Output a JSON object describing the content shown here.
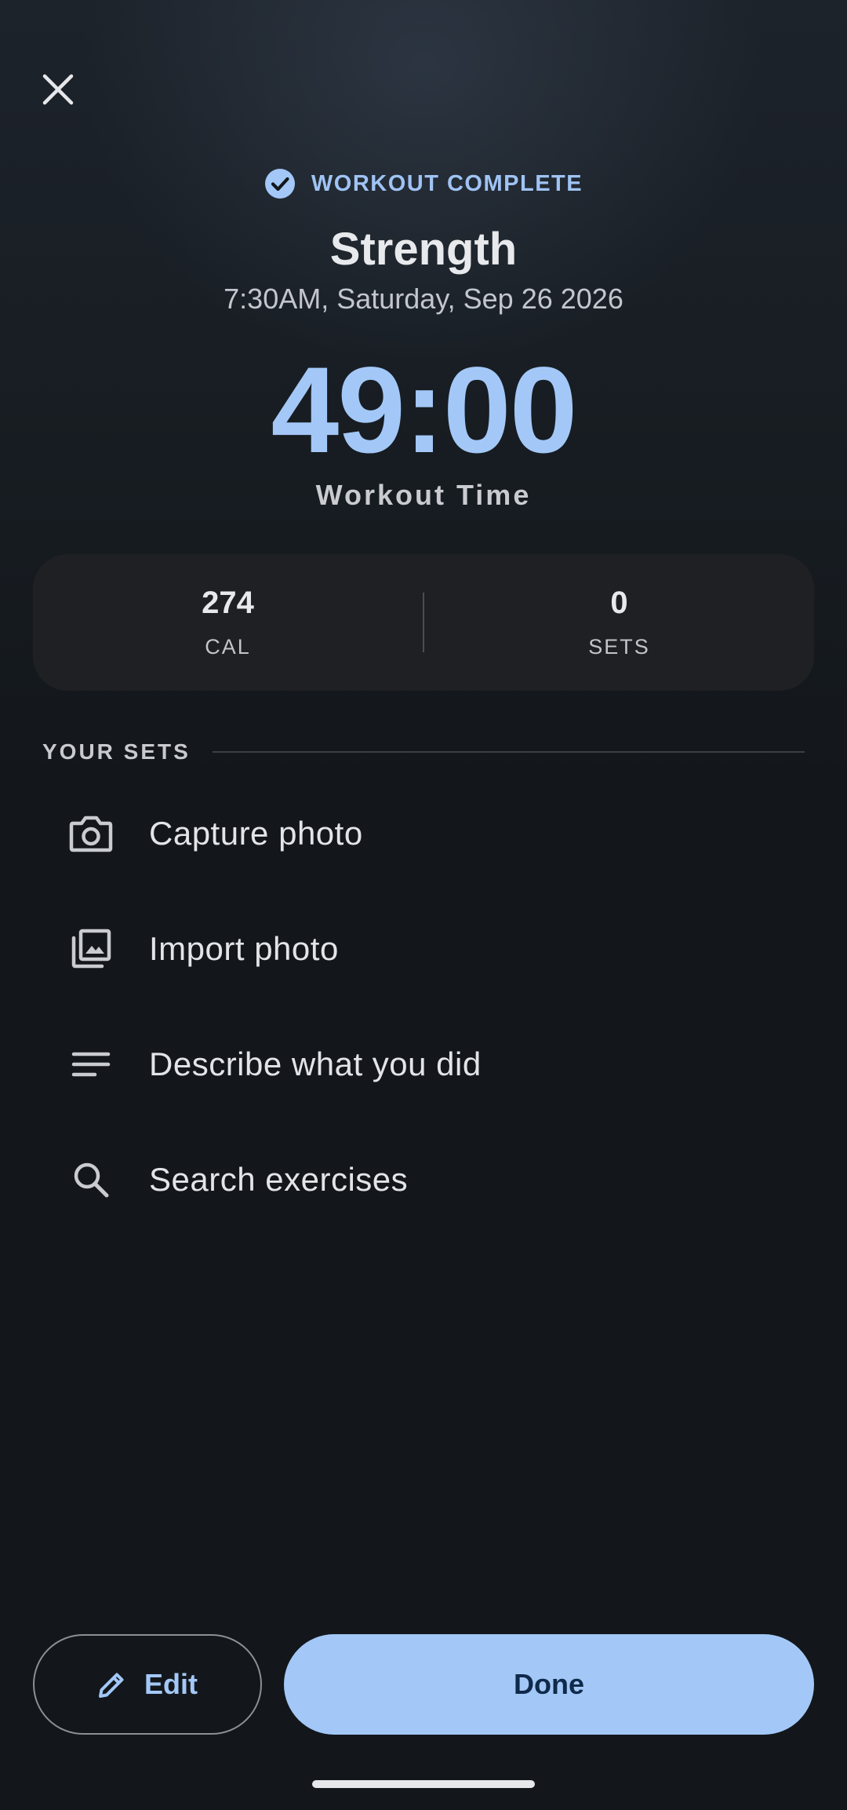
{
  "header": {
    "status": "WORKOUT COMPLETE",
    "title": "Strength",
    "datetime": "7:30AM, Saturday, Sep 26 2026"
  },
  "timer": {
    "value": "49:00",
    "label": "Workout Time"
  },
  "stats": [
    {
      "value": "274",
      "label": "CAL"
    },
    {
      "value": "0",
      "label": "SETS"
    }
  ],
  "sets_section": {
    "title": "YOUR SETS",
    "options": [
      {
        "label": "Capture photo",
        "icon": "camera-icon"
      },
      {
        "label": "Import photo",
        "icon": "photo-library-icon"
      },
      {
        "label": "Describe what you did",
        "icon": "notes-icon"
      },
      {
        "label": "Search exercises",
        "icon": "search-icon"
      }
    ]
  },
  "actions": {
    "edit_label": "Edit",
    "done_label": "Done"
  },
  "colors": {
    "accent": "#a3c8f7",
    "background": "#13171b",
    "card": "#1f2024"
  }
}
